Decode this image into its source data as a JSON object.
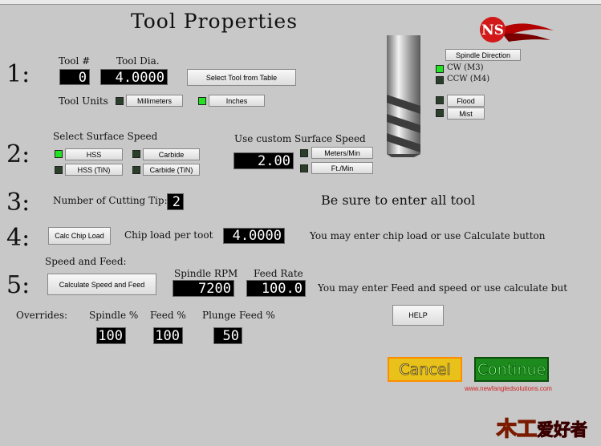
{
  "window": {
    "title": "Tool Properties"
  },
  "steps": {
    "s1": "1:",
    "s2": "2:",
    "s3": "3:",
    "s4": "4:",
    "s5": "5:"
  },
  "tool": {
    "number_label": "Tool #",
    "number_value": "0",
    "dia_label": "Tool Dia.",
    "dia_value": "4.0000",
    "select_button": "Select Tool from Table",
    "units_label": "Tool Units",
    "units_mm": "Millimeters",
    "units_in": "Inches",
    "units_selected": "Inches"
  },
  "spindle": {
    "direction_button": "Spindle Direction",
    "cw_label": "CW (M3)",
    "ccw_label": "CCW (M4)",
    "flood_button": "Flood",
    "mist_button": "Mist"
  },
  "surface": {
    "select_label": "Select Surface Speed",
    "hss": "HSS",
    "carbide": "Carbide",
    "hss_tin": "HSS (TiN)",
    "carbide_tin": "Carbide (TiN)",
    "custom_label": "Use custom Surface Speed",
    "custom_value": "2.00",
    "meters_button": "Meters/Min",
    "ft_button": "Ft./Min"
  },
  "cutting": {
    "tip_label": "Number of Cutting Tip:",
    "tip_value": "2",
    "notice": "Be sure to enter all tool"
  },
  "chip": {
    "calc_button": "Calc Chip Load",
    "load_label": "Chip load per toot",
    "load_value": "4.0000",
    "hint": "You may enter chip load or use Calculate button"
  },
  "feed": {
    "section_label": "Speed and Feed:",
    "calc_button": "Calculate Speed and Feed",
    "rpm_label": "Spindle RPM",
    "rpm_value": "7200",
    "rate_label": "Feed Rate",
    "rate_value": "100.0",
    "hint": "You may enter Feed and speed or use calculate but"
  },
  "overrides": {
    "label": "Overrides:",
    "spindle_label": "Spindle %",
    "spindle_value": "100",
    "feed_label": "Feed %",
    "feed_value": "100",
    "plunge_label": "Plunge Feed %",
    "plunge_value": "50",
    "help_button": "HELP"
  },
  "actions": {
    "cancel": "Cancel",
    "continue": "Continue"
  },
  "footer": {
    "url": "www.newfangledsolutions.com",
    "watermark": "木工爱好者"
  },
  "colors": {
    "led_on": "#21e321",
    "led_off": "#2a3f2a",
    "background": "#c8c8c8"
  }
}
